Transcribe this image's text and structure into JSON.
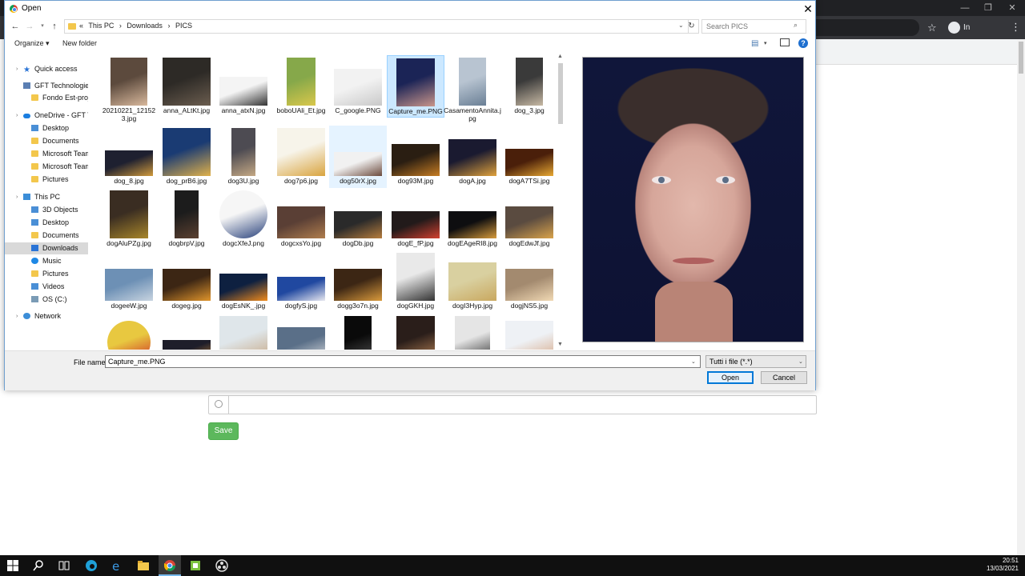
{
  "dialog": {
    "title": "Open",
    "close_glyph": "✕",
    "address": {
      "crumbs": [
        "This PC",
        "›",
        "Downloads",
        "›",
        "PICS"
      ],
      "chevron": "«"
    },
    "search_placeholder": "Search PICS",
    "commands": {
      "organize": "Organize ▾",
      "new_folder": "New folder"
    },
    "nav": [
      {
        "label": "Quick access",
        "icon": "star"
      },
      {
        "label": "GFT Technologies SE",
        "icon": "gft"
      },
      {
        "label": "Fondo Est-projects-",
        "icon": "folder"
      },
      {
        "label": "OneDrive - GFT Techn",
        "icon": "cloud"
      },
      {
        "label": "Desktop",
        "icon": "blue"
      },
      {
        "label": "Documents",
        "icon": "folder"
      },
      {
        "label": "Microsoft Teams Ch",
        "icon": "folder"
      },
      {
        "label": "Microsoft Teams Da",
        "icon": "folder"
      },
      {
        "label": "Pictures",
        "icon": "folder"
      },
      {
        "label": "This PC",
        "icon": "pc"
      },
      {
        "label": "3D Objects",
        "icon": "blue"
      },
      {
        "label": "Desktop",
        "icon": "blue"
      },
      {
        "label": "Documents",
        "icon": "folder"
      },
      {
        "label": "Downloads",
        "icon": "dl"
      },
      {
        "label": "Music",
        "icon": "music"
      },
      {
        "label": "Pictures",
        "icon": "folder"
      },
      {
        "label": "Videos",
        "icon": "blue"
      },
      {
        "label": "OS (C:)",
        "icon": "drive"
      },
      {
        "label": "Network",
        "icon": "net"
      }
    ],
    "files": [
      "20210221_121523.jpg",
      "anna_ALtKt.jpg",
      "anna_atxN.jpg",
      "boboUAli_Et.jpg",
      "C_google.PNG",
      "Capture_me.PNG",
      "CasamentoAnnita.jpg",
      "dog_3.jpg",
      "dog_8.jpg",
      "dog_prB6.jpg",
      "dog3U.jpg",
      "dog7p6.jpg",
      "dog50rX.jpg",
      "dog93M.jpg",
      "dogA.jpg",
      "dogA7TSi.jpg",
      "dogAluPZg.jpg",
      "dogbrpV.jpg",
      "dogcXfeJ.png",
      "dogcxsYo.jpg",
      "dogDb.jpg",
      "dogE_fP.jpg",
      "dogEAgeRI8.jpg",
      "dogEdwJf.jpg",
      "dogeeW.jpg",
      "dogeg.jpg",
      "dogEsNK_.jpg",
      "dogfyS.jpg",
      "dogg3o7n.jpg",
      "dogGKH.jpg",
      "dogI3Hyp.jpg",
      "dogjNS5.jpg",
      "",
      "",
      "",
      "",
      "",
      "",
      "",
      ""
    ],
    "selected_file": "Capture_me.PNG",
    "hover_file": "dog50rX.jpg",
    "filename_label": "File name:",
    "filename_value": "Capture_me.PNG",
    "filter_value": "Tutti i file (*.*)",
    "open_label": "Open",
    "cancel_label": "Cancel"
  },
  "browser": {
    "incognito_label": "In incognito",
    "window_controls": [
      "—",
      "❐",
      "✕"
    ]
  },
  "form": {
    "save_label": "Save"
  },
  "taskbar": {
    "time": "20:51",
    "date": "13/03/2021"
  },
  "colors": {
    "accent": "#0078d7",
    "save_green": "#5cb85c",
    "selection": "#cce8ff"
  }
}
